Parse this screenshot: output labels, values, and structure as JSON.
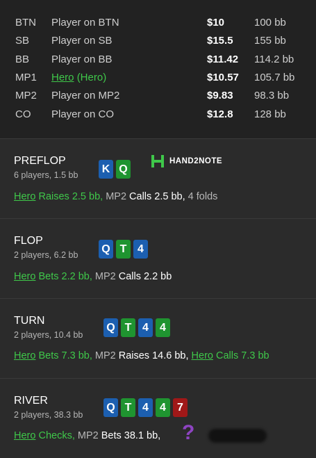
{
  "players": [
    {
      "pos": "BTN",
      "name": "Player on BTN",
      "money": "$10",
      "bb": "100 bb"
    },
    {
      "pos": "SB",
      "name": "Player on SB",
      "money": "$15.5",
      "bb": "155 bb"
    },
    {
      "pos": "BB",
      "name": "Player on BB",
      "money": "$11.42",
      "bb": "114.2 bb"
    },
    {
      "pos": "MP1",
      "name": "Hero",
      "name_suffix": "(Hero)",
      "money": "$10.57",
      "bb": "105.7 bb"
    },
    {
      "pos": "MP2",
      "name": "Player on MP2",
      "money": "$9.83",
      "bb": "98.3 bb"
    },
    {
      "pos": "CO",
      "name": "Player on CO",
      "money": "$12.8",
      "bb": "128 bb"
    }
  ],
  "logo": {
    "text": "HAND2NOTE"
  },
  "preflop": {
    "title": "PREFLOP",
    "sub": "6 players, 1.5 bb",
    "cards": [
      {
        "rank": "K",
        "color": "#1c5fb0"
      },
      {
        "rank": "Q",
        "color": "#1f9430"
      }
    ],
    "a1": "Hero",
    "a2": " Raises 2.5 bb,",
    "a3": " MP2",
    "a4": " Calls 2.5 bb,",
    "a5": " 4 folds"
  },
  "flop": {
    "title": "FLOP",
    "sub": "2 players, 6.2 bb",
    "cards": [
      {
        "rank": "Q",
        "color": "#1c5fb0"
      },
      {
        "rank": "T",
        "color": "#1f9430"
      },
      {
        "rank": "4",
        "color": "#1c5fb0"
      }
    ],
    "a1": "Hero",
    "a2": " Bets 2.2 bb,",
    "a3": " MP2",
    "a4": " Calls 2.2 bb"
  },
  "turn": {
    "title": "TURN",
    "sub": "2 players, 10.4 bb",
    "cards": [
      {
        "rank": "Q",
        "color": "#1c5fb0"
      },
      {
        "rank": "T",
        "color": "#1f9430"
      },
      {
        "rank": "4",
        "color": "#1c5fb0"
      },
      {
        "rank": "4",
        "color": "#1f9430"
      }
    ],
    "a1": "Hero",
    "a2": " Bets 7.3 bb,",
    "a3": " MP2",
    "a4": " Raises 14.6 bb,",
    "a5": "Hero",
    "a6": " Calls 7.3 bb"
  },
  "river": {
    "title": "RIVER",
    "sub": "2 players, 38.3 bb",
    "cards": [
      {
        "rank": "Q",
        "color": "#1c5fb0"
      },
      {
        "rank": "T",
        "color": "#1f9430"
      },
      {
        "rank": "4",
        "color": "#1c5fb0"
      },
      {
        "rank": "4",
        "color": "#1f9430"
      },
      {
        "rank": "7",
        "color": "#a01818"
      }
    ],
    "a1": "Hero",
    "a2": " Checks,",
    "a3": " MP2",
    "a4": " Bets 38.1 bb,",
    "hidden_action_mark": "?"
  }
}
